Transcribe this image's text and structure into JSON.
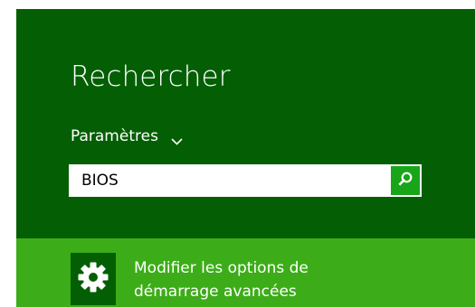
{
  "search_panel": {
    "title": "Rechercher",
    "scope_label": "Paramètres",
    "scope_icon": "chevron-down-icon",
    "search": {
      "value": "BIOS",
      "placeholder": "",
      "button_icon": "search-icon"
    }
  },
  "results": [
    {
      "icon": "gear-icon",
      "line1": "Modifier les options de",
      "line2": "démarrage avancées"
    }
  ],
  "colors": {
    "panel_bg": "#045f04",
    "result_bg": "#3cad18",
    "search_button": "#19a519",
    "text": "#ffffff"
  }
}
